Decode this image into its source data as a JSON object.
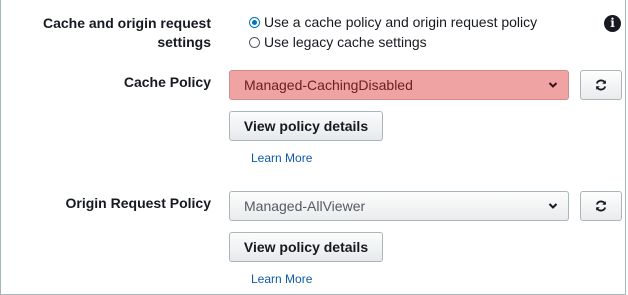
{
  "cache_settings": {
    "label_line1": "Cache and origin request",
    "label_line2": "settings",
    "options": [
      {
        "label": "Use a cache policy and origin request policy",
        "checked": true
      },
      {
        "label": "Use legacy cache settings",
        "checked": false
      }
    ],
    "info_icon": "info-icon"
  },
  "cache_policy": {
    "label": "Cache Policy",
    "selected": "Managed-CachingDisabled",
    "state": "error",
    "view_button": "View policy details",
    "learn_more": "Learn More"
  },
  "origin_request_policy": {
    "label": "Origin Request Policy",
    "selected": "Managed-AllViewer",
    "view_button": "View policy details",
    "learn_more": "Learn More"
  },
  "icons": {
    "dropdown": "chevron-down-icon",
    "refresh": "refresh-icon"
  },
  "colors": {
    "error_background": "#f0a3a3",
    "link": "#0f5aa8",
    "radio_selected": "#0073bb"
  }
}
